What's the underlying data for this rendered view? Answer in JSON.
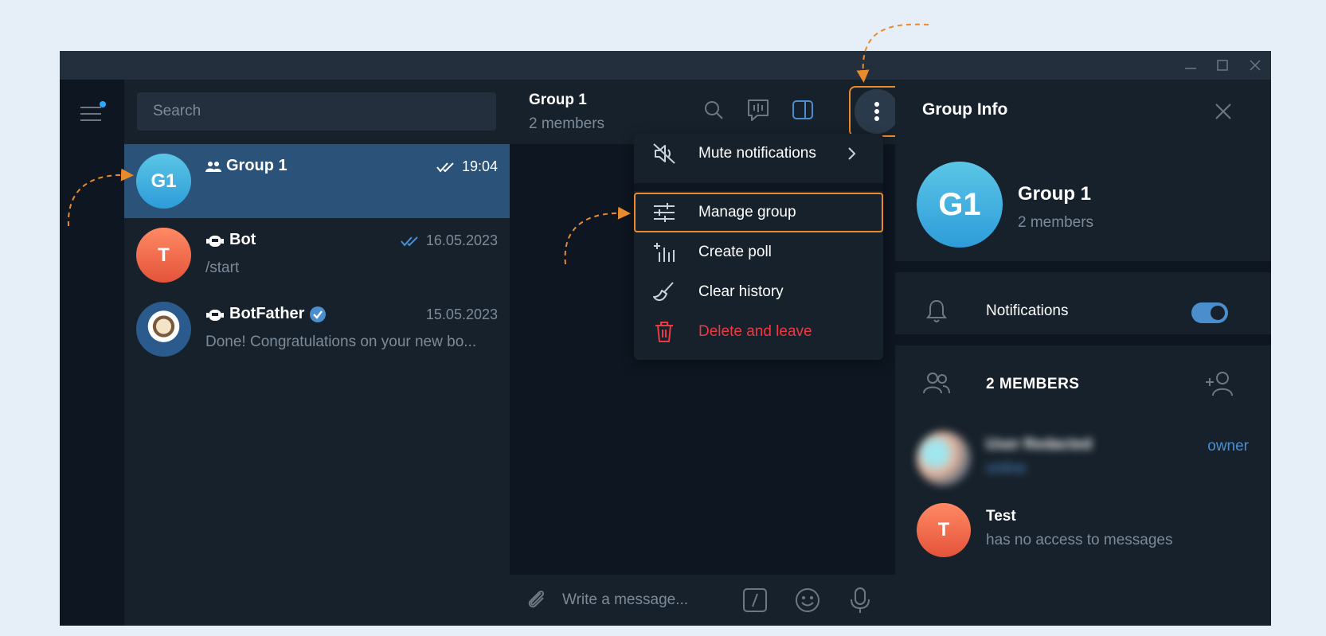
{
  "search": {
    "placeholder": "Search"
  },
  "chats": [
    {
      "name": "Group 1",
      "time": "19:04",
      "avatar_initials": "G1",
      "preview": "",
      "type_icon": "group-icon",
      "read": true,
      "active": true
    },
    {
      "name": "Bot",
      "time": "16.05.2023",
      "avatar_initials": "T",
      "preview": "/start",
      "type_icon": "bot-icon",
      "read": true,
      "active": false
    },
    {
      "name": "BotFather",
      "time": "15.05.2023",
      "avatar_initials": "",
      "preview": "Done! Congratulations on your new bo...",
      "type_icon": "bot-icon",
      "verified": true,
      "active": false
    }
  ],
  "chat_header": {
    "title": "Group 1",
    "subtitle": "2 members"
  },
  "composer": {
    "placeholder": "Write a message..."
  },
  "dropdown": {
    "items": [
      {
        "label": "Mute notifications",
        "icon": "mute-icon"
      },
      {
        "label": "Manage group",
        "icon": "sliders-icon"
      },
      {
        "label": "Create poll",
        "icon": "poll-icon"
      },
      {
        "label": "Clear history",
        "icon": "broom-icon"
      },
      {
        "label": "Delete and leave",
        "icon": "trash-icon"
      }
    ]
  },
  "info_panel": {
    "title": "Group Info",
    "group_name": "Group 1",
    "group_initials": "G1",
    "group_sub": "2 members",
    "notifications_label": "Notifications",
    "notifications_on": true,
    "members_label": "2 MEMBERS",
    "members": [
      {
        "name": "User Redacted",
        "status": "online",
        "role": "owner",
        "blurred": true
      },
      {
        "name": "Test",
        "status": "has no access to messages",
        "initials": "T",
        "role": ""
      }
    ]
  },
  "colors": {
    "accent": "#4b8ece",
    "danger": "#ec3942",
    "highlight": "#e98b2a",
    "active_row": "#2b5278"
  }
}
